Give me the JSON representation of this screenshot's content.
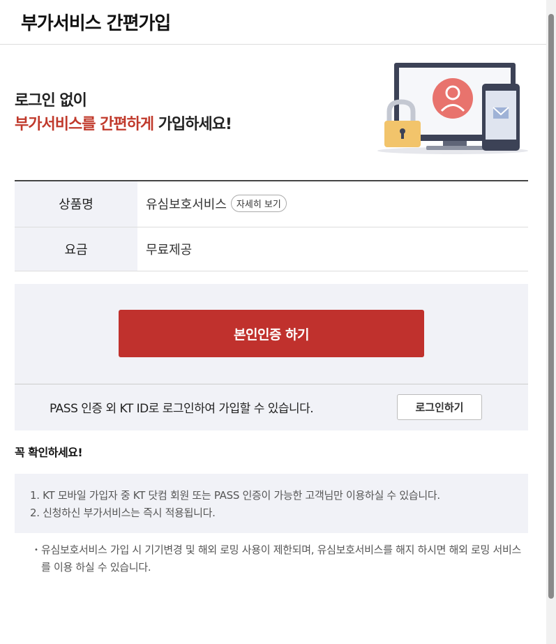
{
  "header": {
    "title": "부가서비스 간편가입"
  },
  "hero": {
    "line1": "로그인 없이",
    "line2_accent": "부가서비스를 간편하게",
    "line2_rest": " 가입하세요!"
  },
  "info_table": {
    "product_label": "상품명",
    "product_value": "유심보호서비스",
    "detail_button": "자세히 보기",
    "fee_label": "요금",
    "fee_value": "무료제공"
  },
  "auth": {
    "button_label": "본인인증 하기",
    "alt_message": "PASS 인증 외 KT ID로 로그인하여 가입할 수 있습니다.",
    "login_button": "로그인하기"
  },
  "notice": {
    "title": "꼭 확인하세요!",
    "items": [
      "1. KT 모바일 가입자 중 KT 닷컴 회원 또는 PASS 인증이 가능한 고객님만 이용하실 수 있습니다.",
      "2. 신청하신 부가서비스는 즉시 적용됩니다."
    ],
    "footnote": "유심보호서비스 가입 시 기기변경 및 해외 로밍 사용이 제한되며, 유심보호서비스를 해지 하시면 해외 로밍 서비스를 이용 하실 수 있습니다."
  },
  "icons": {
    "illustration": "monitor-lock-phone-illustration"
  },
  "colors": {
    "accent": "#c0312d",
    "panel_bg": "#f1f2f7"
  }
}
